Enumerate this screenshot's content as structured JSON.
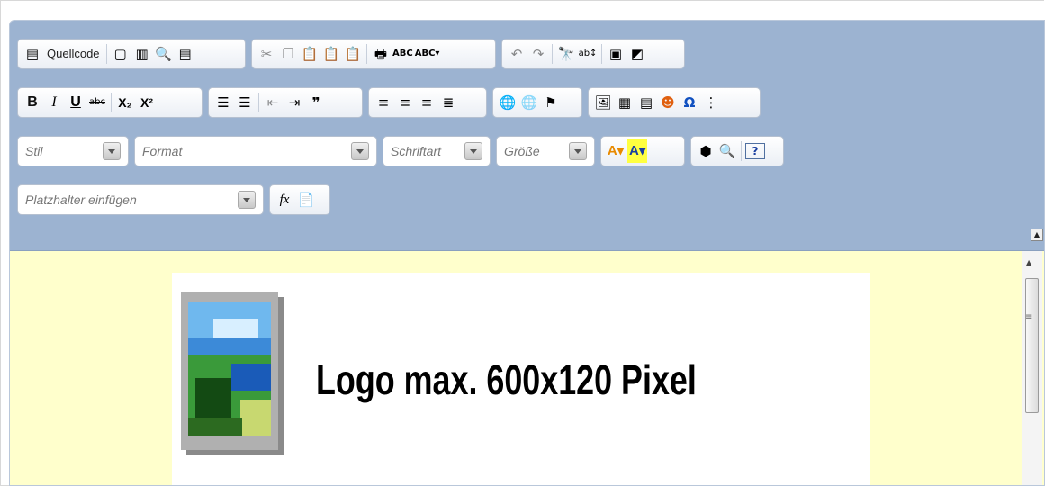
{
  "toolbar": {
    "row1": {
      "source_label": "Quellcode"
    },
    "row3": {
      "style_placeholder": "Stil",
      "format_placeholder": "Format",
      "font_placeholder": "Schriftart",
      "size_placeholder": "Größe"
    },
    "row4": {
      "placeholder_insert": "Platzhalter einfügen",
      "fx_label": "fx"
    },
    "row2": {
      "bold": "B",
      "italic": "I",
      "underline": "U",
      "strike": "abc"
    }
  },
  "content": {
    "logo_text": "Logo max. 600x120 Pixel",
    "background_color": "#ffffcc"
  },
  "colors": {
    "toolbar_bg": "#9cb3d1",
    "group_bg": "#f4f6fa"
  }
}
